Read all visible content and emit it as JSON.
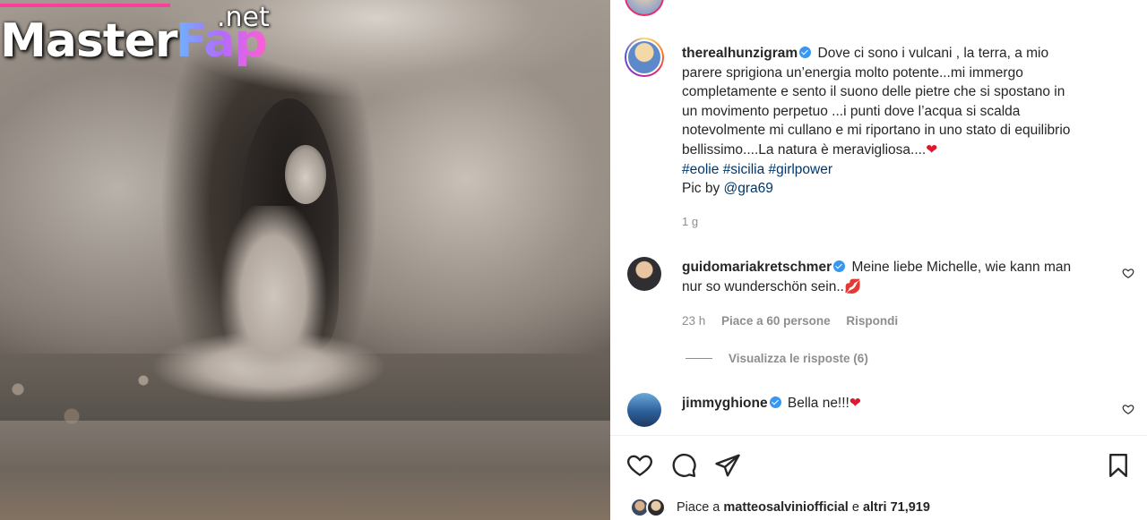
{
  "watermark": {
    "brand_left": "Master",
    "brand_right": "Fap",
    "suffix": ".net"
  },
  "post": {
    "author": "therealhunzigram",
    "caption_lines": [
      "Dove ci sono i vulcani , la terra, a mio",
      "parere sprigiona un’energia molto potente...mi immergo",
      "completamente e sento il suono delle pietre che si spostano in",
      "un movimento perpetuo ...i punti dove l’acqua si scalda",
      "notevolmente mi cullano e mi riportano in uno stato di equilibrio",
      "bellissimo....La natura è meravigliosa...."
    ],
    "caption_emoji": "❤",
    "hashtags": [
      "#eolie",
      "#sicilia",
      "#girlpower"
    ],
    "pic_by_label": "Pic by",
    "pic_by_handle": "@gra69",
    "time": "1 g"
  },
  "comments": [
    {
      "user": "guidomariakretschmer",
      "text_line1": "Meine liebe Michelle, wie kann man",
      "text_line2": "nur so wunderschön sein..",
      "emoji": "💋",
      "time": "23 h",
      "likes": "Piace a 60 persone",
      "reply": "Rispondi",
      "view_replies": "Visualizza le risposte (6)"
    },
    {
      "user": "jimmyghione",
      "text": "Bella ne!!!",
      "emoji": "❤"
    }
  ],
  "likes_bar": {
    "prefix": "Piace a",
    "user": "matteosalviniofficial",
    "middle": "e",
    "others": "altri 71,919"
  },
  "icons": [
    "heart-icon",
    "comment-icon",
    "share-icon",
    "bookmark-icon",
    "verified-icon"
  ],
  "colors": {
    "verified": "#3897f0",
    "hashtag": "#00376b",
    "muted": "#8e8e8e",
    "heart": "#e0182d"
  }
}
